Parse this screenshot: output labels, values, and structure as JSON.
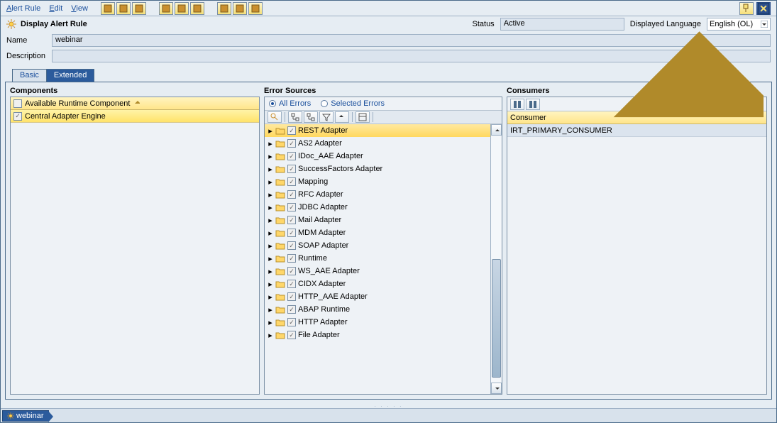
{
  "menu": {
    "alert_rule": "Alert Rule",
    "edit": "Edit",
    "view": "View"
  },
  "toolbar_icons": [
    "wand-icon",
    "copy-icon",
    "sheets-icon",
    "back-icon",
    "goto-icon",
    "variant-icon",
    "print-icon",
    "log-icon",
    "user-icon"
  ],
  "header": {
    "icon": "sun-icon",
    "title": "Display Alert Rule",
    "status_label": "Status",
    "status_value": "Active",
    "lang_label": "Displayed Language",
    "lang_value": "English (OL)"
  },
  "form": {
    "name_label": "Name",
    "name_value": "webinar",
    "desc_label": "Description",
    "desc_value": ""
  },
  "tabs": {
    "basic": "Basic",
    "extended": "Extended",
    "active": "extended"
  },
  "components": {
    "title": "Components",
    "header": "Available Runtime Component",
    "items": [
      "Central Adapter Engine"
    ]
  },
  "error_sources": {
    "title": "Error Sources",
    "radio_all": "All Errors",
    "radio_sel": "Selected Errors",
    "radio_checked": "all",
    "tree": [
      "REST Adapter",
      "AS2 Adapter",
      "IDoc_AAE Adapter",
      "SuccessFactors Adapter",
      "Mapping",
      "RFC Adapter",
      "JDBC Adapter",
      "Mail Adapter",
      "MDM Adapter",
      "SOAP Adapter",
      "Runtime",
      "WS_AAE Adapter",
      "CIDX Adapter",
      "HTTP_AAE Adapter",
      "ABAP Runtime",
      "HTTP Adapter",
      "File Adapter"
    ],
    "selected": 0
  },
  "consumers": {
    "title": "Consumers",
    "header": "Consumer",
    "rows": [
      "IRT_PRIMARY_CONSUMER"
    ]
  },
  "bottom": {
    "tab": "webinar"
  }
}
